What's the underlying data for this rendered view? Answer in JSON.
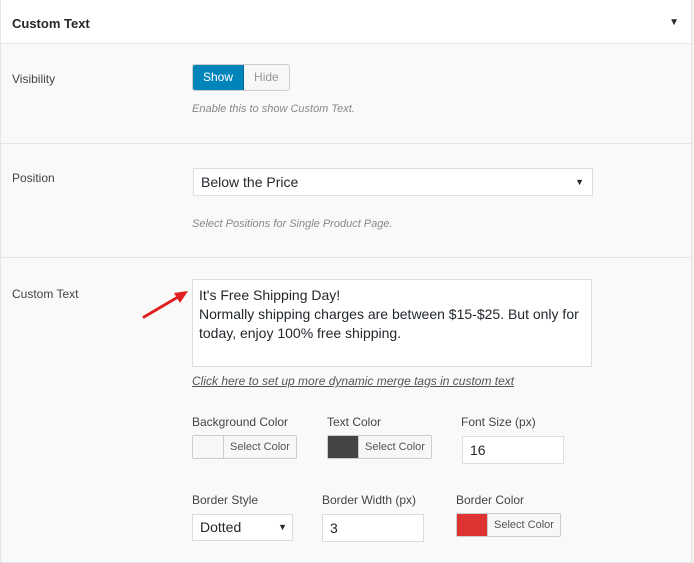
{
  "header": {
    "title": "Custom Text",
    "toggle_icon": "▼"
  },
  "visibility": {
    "label": "Visibility",
    "options": [
      "Show",
      "Hide"
    ],
    "selected": "Show",
    "description": "Enable this to show Custom Text."
  },
  "position": {
    "label": "Position",
    "selected": "Below the Price",
    "description": "Select Positions for Single Product Page."
  },
  "custom_text": {
    "label": "Custom Text",
    "value": "It's Free Shipping Day!\nNormally shipping charges are between $15-$25. But only for today, enjoy 100% free shipping.",
    "link": "Click here to set up more dynamic merge tags in custom text"
  },
  "style": {
    "background_color": {
      "label": "Background Color",
      "button": "Select Color",
      "swatch": "#f7f7f7"
    },
    "text_color": {
      "label": "Text Color",
      "button": "Select Color",
      "swatch": "#444444"
    },
    "font_size": {
      "label": "Font Size (px)",
      "value": "16"
    },
    "border_style": {
      "label": "Border Style",
      "selected": "Dotted"
    },
    "border_width": {
      "label": "Border Width (px)",
      "value": "3"
    },
    "border_color": {
      "label": "Border Color",
      "button": "Select Color",
      "swatch": "#dd3333"
    }
  },
  "colors": {
    "accent": "#0085ba",
    "annotation_arrow": "#e02020"
  }
}
